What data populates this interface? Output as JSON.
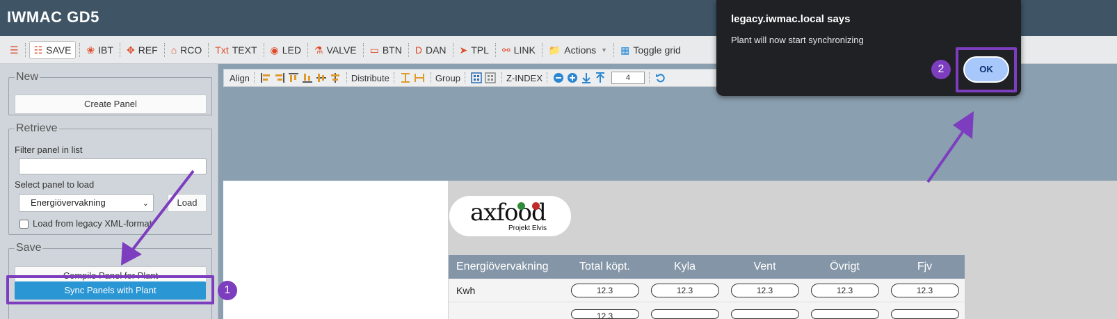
{
  "app": {
    "title": "IWMAC GD5"
  },
  "toolbar": {
    "save": "SAVE",
    "ibt": "IBT",
    "ref": "REF",
    "rco": "RCO",
    "text_prefix": "Txt",
    "text": "TEXT",
    "led": "LED",
    "valve": "VALVE",
    "btn": "BTN",
    "dan_prefix": "D",
    "dan": "DAN",
    "tpl": "TPL",
    "link": "LINK",
    "actions": "Actions",
    "toggle_grid": "Toggle grid"
  },
  "left": {
    "new_legend": "New",
    "create_panel": "Create Panel",
    "retrieve_legend": "Retrieve",
    "filter_label": "Filter panel in list",
    "filter_value": "",
    "select_label": "Select panel to load",
    "selected_panel": "Energiövervakning",
    "load_button": "Load",
    "legacy_label": "Load from legacy XML-format",
    "save_legend": "Save",
    "compile_button": "Compile Panel for Plant",
    "sync_button": "Sync Panels with Plant"
  },
  "align_bar": {
    "align": "Align",
    "distribute": "Distribute",
    "group": "Group",
    "zindex": "Z-INDEX",
    "zindex_value": "4"
  },
  "logo": {
    "word": "axfood",
    "sub": "Projekt Elvis"
  },
  "table": {
    "headers": [
      "Energiövervakning",
      "Total köpt.",
      "Kyla",
      "Vent",
      "Övrigt",
      "Fjv"
    ],
    "rows": [
      {
        "label": "Kwh",
        "values": [
          "12.3",
          "12.3",
          "12.3",
          "12.3",
          "12.3"
        ]
      }
    ],
    "partial_row_value": "12.3"
  },
  "dialog": {
    "title": "legacy.iwmac.local says",
    "message": "Plant will now start synchronizing",
    "ok": "OK"
  },
  "annotations": {
    "step1": "1",
    "step2": "2",
    "color": "#7c3dbf"
  },
  "colors": {
    "titlebar": "#3f5566",
    "primary_button": "#2a96d4",
    "table_header": "#8395a6",
    "dialog_bg": "#202124",
    "ok_button": "#a8c7fa"
  }
}
